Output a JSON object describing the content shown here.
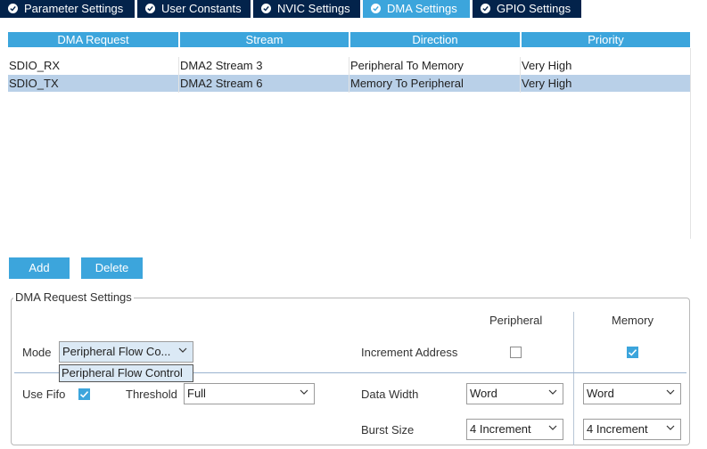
{
  "tabs": [
    {
      "label": "Parameter Settings",
      "active": false
    },
    {
      "label": "User Constants",
      "active": false
    },
    {
      "label": "NVIC Settings",
      "active": false
    },
    {
      "label": "DMA Settings",
      "active": true
    },
    {
      "label": "GPIO Settings",
      "active": false
    }
  ],
  "table": {
    "columns": [
      "DMA Request",
      "Stream",
      "Direction",
      "Priority"
    ],
    "rows": [
      {
        "request": "SDIO_RX",
        "stream": "DMA2 Stream 3",
        "direction": "Peripheral To Memory",
        "priority": "Very High",
        "selected": false
      },
      {
        "request": "SDIO_TX",
        "stream": "DMA2 Stream 6",
        "direction": "Memory To Peripheral",
        "priority": "Very High",
        "selected": true
      }
    ]
  },
  "buttons": {
    "add": "Add",
    "delete": "Delete"
  },
  "settings": {
    "title": "DMA Request Settings",
    "peripheral_header": "Peripheral",
    "memory_header": "Memory",
    "mode_label": "Mode",
    "mode_value": "Peripheral Flow Co...",
    "mode_dropdown_option": "Peripheral Flow Control",
    "increment_address_label": "Increment Address",
    "increment_peripheral_checked": false,
    "increment_memory_checked": true,
    "use_fifo_label": "Use Fifo",
    "use_fifo_checked": true,
    "threshold_label": "Threshold",
    "threshold_value": "Full",
    "data_width_label": "Data Width",
    "data_width_peripheral": "Word",
    "data_width_memory": "Word",
    "burst_size_label": "Burst Size",
    "burst_size_peripheral": "4 Increment",
    "burst_size_memory": "4 Increment"
  },
  "colors": {
    "tab_inactive": "#03234b",
    "tab_active": "#3ca5dc",
    "header_blue": "#3ca5dc",
    "selected_row": "#b9d0e8",
    "checkbox_blue": "#3ca5dc"
  },
  "icons": {
    "tab_status": "check-circle-icon",
    "dropdown": "chevron-down-icon",
    "checkbox_checked": "checkmark-icon"
  }
}
